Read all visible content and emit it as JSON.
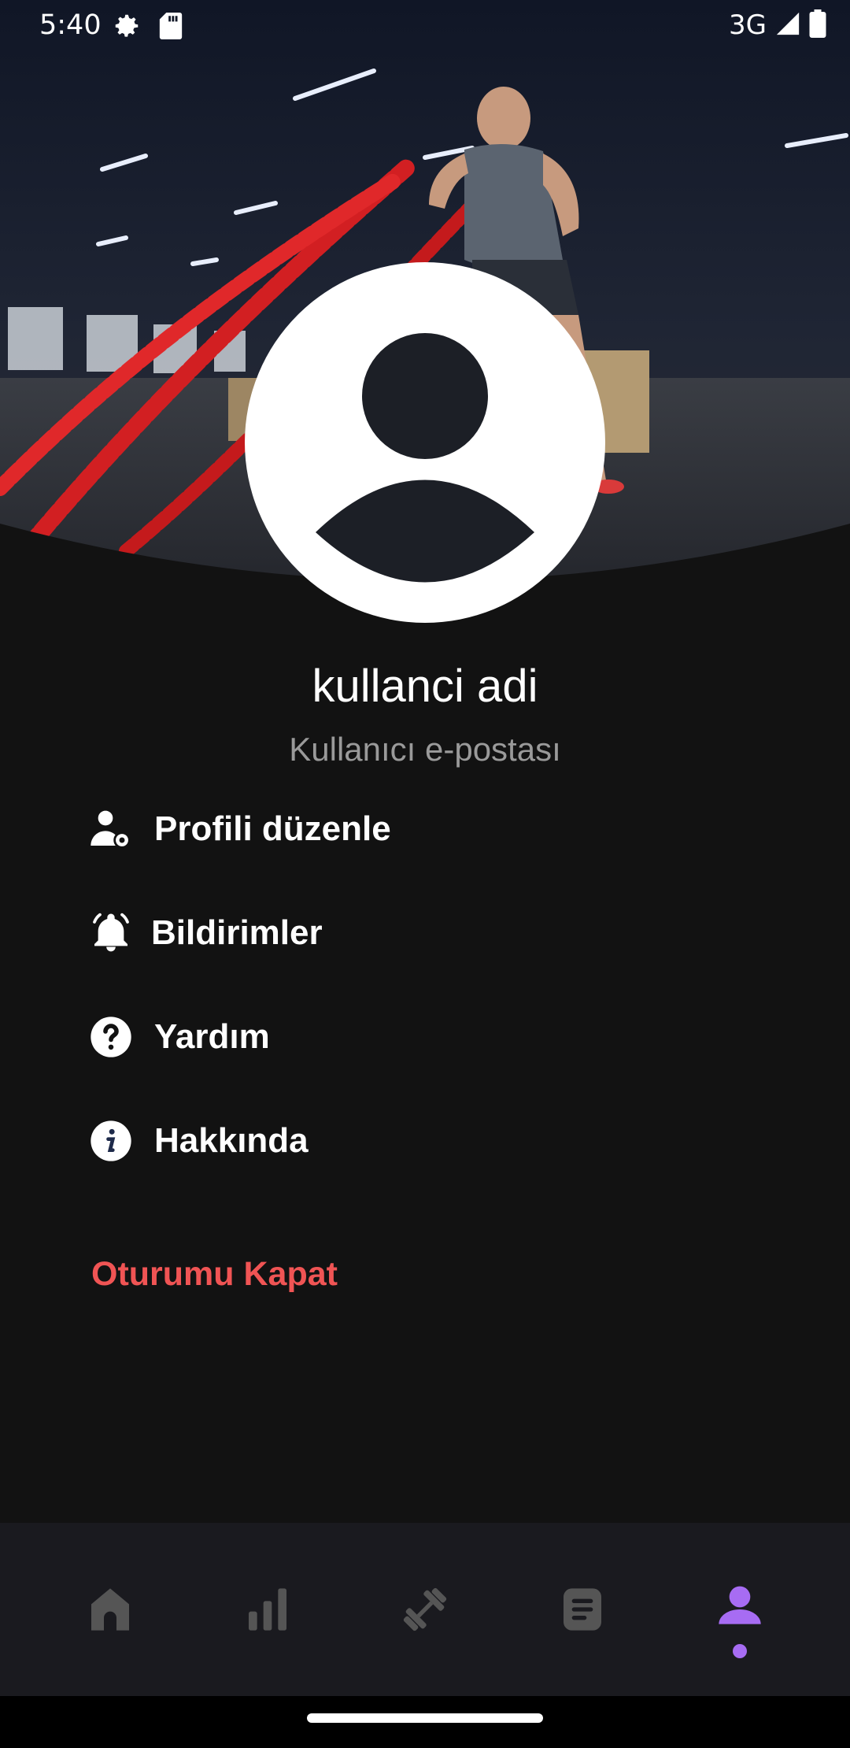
{
  "status_bar": {
    "time": "5:40",
    "network": "3G",
    "icons": [
      "settings-icon",
      "sd-card-icon",
      "signal-icon",
      "battery-icon"
    ]
  },
  "profile": {
    "name": "kullanci adi",
    "email": "Kullanıcı e-postası"
  },
  "menu": {
    "items": [
      {
        "label": "Profili düzenle",
        "icon": "user-settings-icon"
      },
      {
        "label": "Bildirimler",
        "icon": "bell-icon"
      },
      {
        "label": "Yardım",
        "icon": "help-circle-icon"
      },
      {
        "label": "Hakkında",
        "icon": "info-circle-icon"
      }
    ],
    "logout_label": "Oturumu Kapat"
  },
  "bottom_nav": {
    "items": [
      {
        "icon": "home-icon",
        "active": false
      },
      {
        "icon": "bar-chart-icon",
        "active": false
      },
      {
        "icon": "dumbbell-icon",
        "active": false
      },
      {
        "icon": "document-icon",
        "active": false
      },
      {
        "icon": "person-icon",
        "active": true
      }
    ]
  },
  "colors": {
    "background": "#121212",
    "logout": "#f05454",
    "active_nav": "#a76cf3",
    "inactive_nav": "#555555",
    "nav_bg": "#1a1a1f"
  }
}
